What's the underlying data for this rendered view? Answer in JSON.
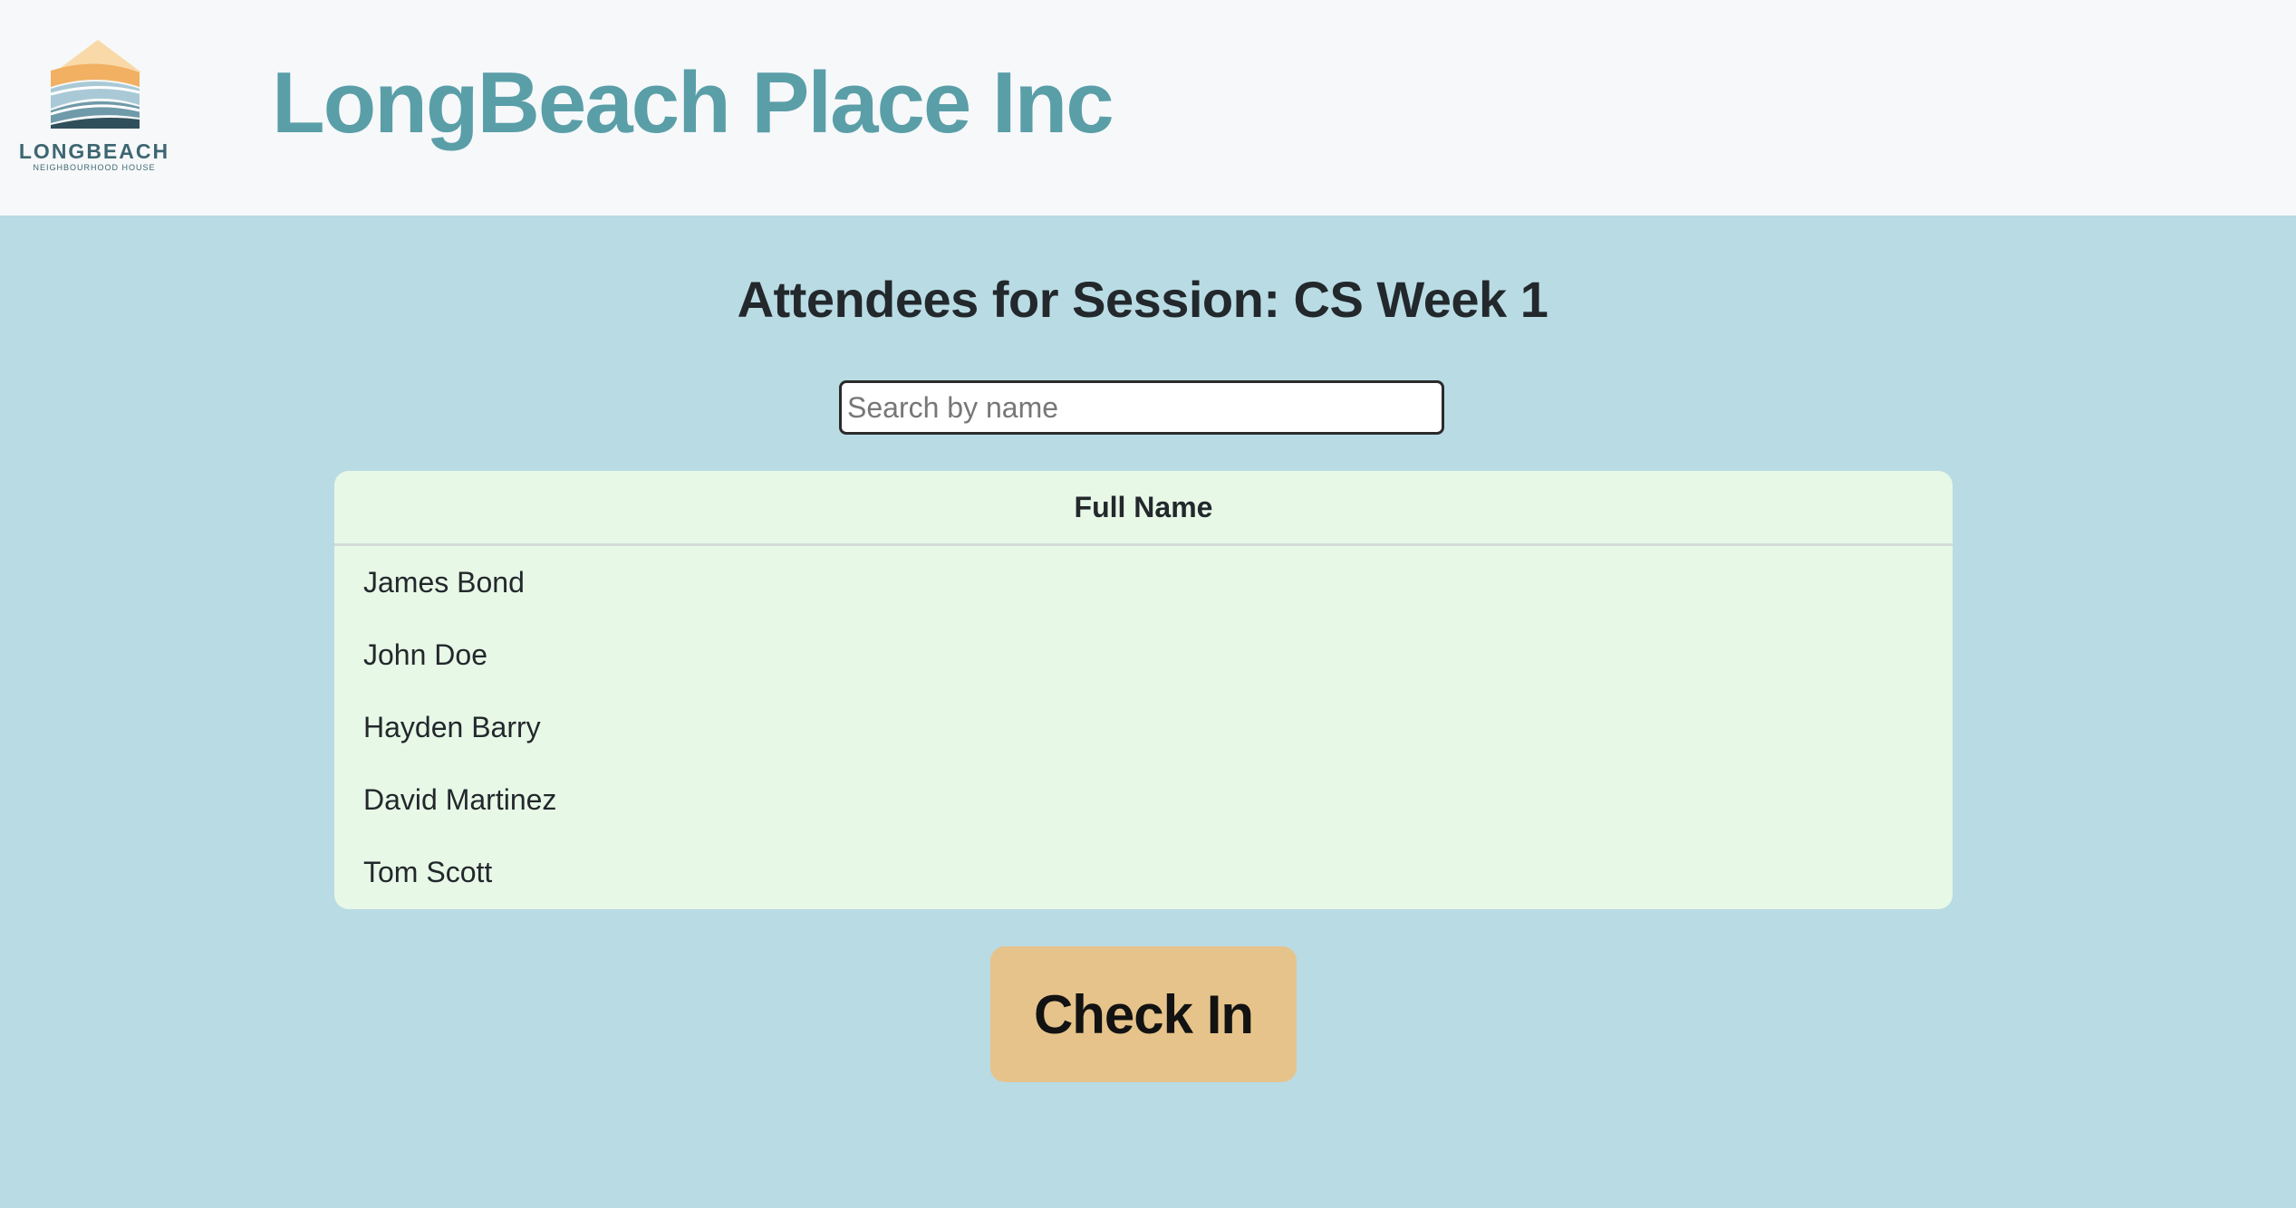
{
  "header": {
    "logo": {
      "wordmark": "LONGBEACH",
      "tagline": "NEIGHBOURHOOD HOUSE"
    },
    "title": "LongBeach Place Inc"
  },
  "main": {
    "session_heading": "Attendees for Session: CS Week 1",
    "search": {
      "placeholder": "Search by name",
      "value": ""
    },
    "table": {
      "columns": [
        "Full Name"
      ],
      "rows": [
        "James Bond",
        "John Doe",
        "Hayden Barry",
        "David Martinez",
        "Tom Scott"
      ]
    },
    "check_in_label": "Check In"
  },
  "colors": {
    "header_bg": "#f6f8f9",
    "page_bg": "#b9dbe4",
    "title": "#5a9ea8",
    "table_bg": "#e8f8e7",
    "button_bg": "#e6c38b"
  }
}
